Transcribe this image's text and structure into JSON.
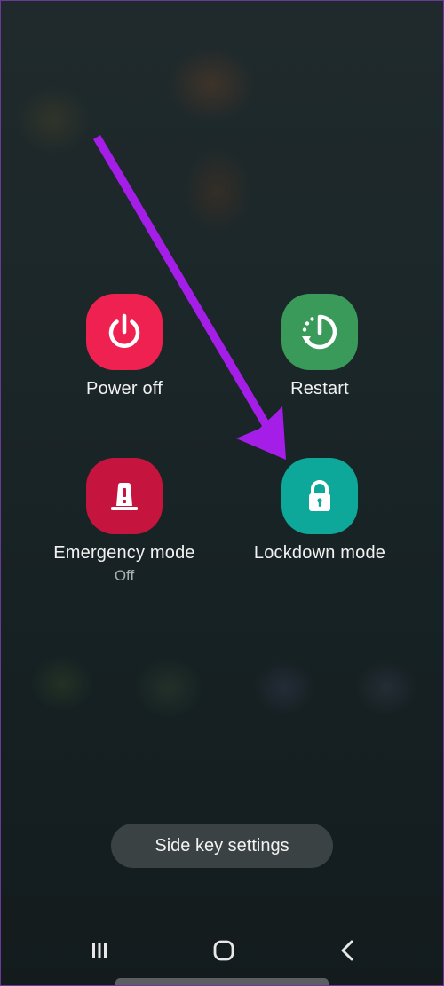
{
  "power_menu": {
    "options": [
      {
        "label": "Power off",
        "icon": "power-icon",
        "color": "#ee2150"
      },
      {
        "label": "Restart",
        "icon": "restart-icon",
        "color": "#3a9a5a"
      },
      {
        "label": "Emergency mode",
        "sublabel": "Off",
        "icon": "emergency-light-icon",
        "color": "#c5153f"
      },
      {
        "label": "Lockdown mode",
        "icon": "lock-icon",
        "color": "#0ea89a"
      }
    ],
    "side_key_button": "Side key settings"
  },
  "annotation": {
    "type": "arrow",
    "color": "#a41ee8",
    "points_to": "Lockdown mode"
  },
  "navigation_bar": {
    "buttons": [
      "recents-icon",
      "home-icon",
      "back-icon"
    ]
  }
}
